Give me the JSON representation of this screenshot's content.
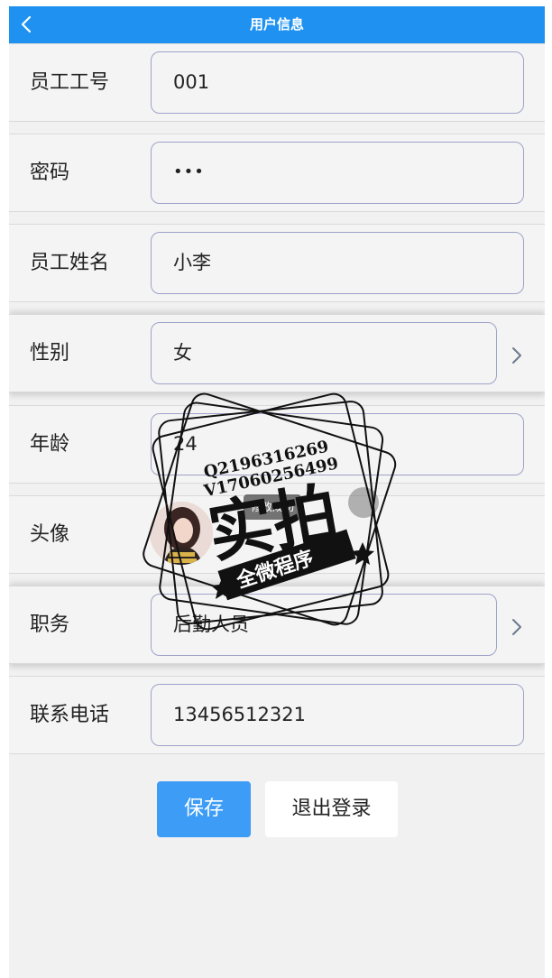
{
  "navbar": {
    "title": "用户信息",
    "back_icon": "chevron-left-icon"
  },
  "form": {
    "fields": [
      {
        "key": "employee_id",
        "label": "员工工号",
        "value": "001"
      },
      {
        "key": "password",
        "label": "密码",
        "value": "•••"
      },
      {
        "key": "employee_name",
        "label": "员工姓名",
        "value": "小李"
      },
      {
        "key": "gender",
        "label": "性别",
        "value": "女"
      },
      {
        "key": "age",
        "label": "年龄",
        "value": "24"
      },
      {
        "key": "avatar",
        "label": "头像"
      },
      {
        "key": "position",
        "label": "职务",
        "value": "后勤人员"
      },
      {
        "key": "phone",
        "label": "联系电话",
        "value": "13456512321"
      }
    ]
  },
  "actions": {
    "save_label": "保存",
    "logout_label": "退出登录"
  },
  "toast": {
    "text": "修改成功"
  },
  "watermark": {
    "line1": "Q2196316269",
    "line2": "V17060256499",
    "main": "实拍",
    "banner": "全微程序"
  },
  "colors": {
    "navbar": "#1f92f1",
    "save_button": "#3d9cf5",
    "field_border": "#9da3c9"
  }
}
